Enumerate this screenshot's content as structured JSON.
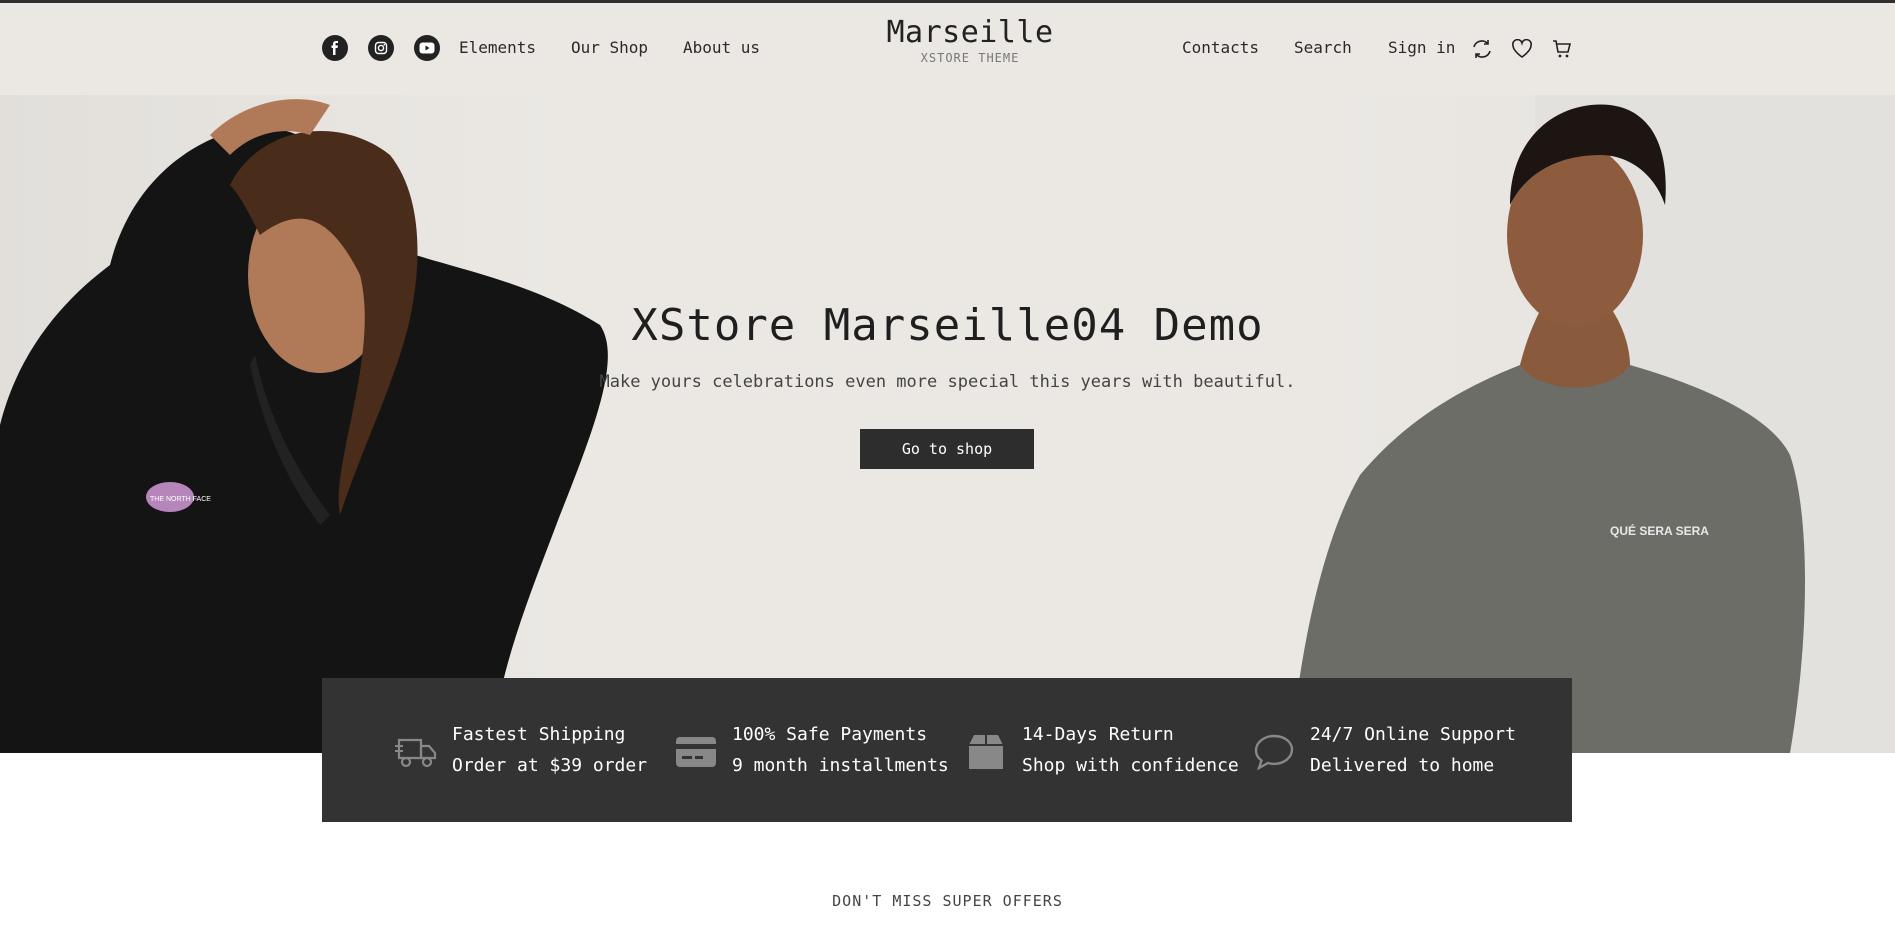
{
  "header": {
    "nav_left": [
      "Elements",
      "Our Shop",
      "About us"
    ],
    "logo_title": "Marseille",
    "logo_subtitle": "XSTORE THEME",
    "nav_right": [
      "Contacts",
      "Search",
      "Sign in"
    ],
    "social_icons": [
      "facebook-icon",
      "instagram-icon",
      "youtube-icon"
    ],
    "action_icons": [
      "compare-icon",
      "heart-icon",
      "cart-icon"
    ]
  },
  "hero": {
    "title": "XStore Marseille04 Demo",
    "subtitle": "Make yours celebrations even more special this years with beautiful.",
    "button_label": "Go to shop",
    "left_badge": "THE NORTH FACE",
    "right_print": "QUÉ SERA SERA"
  },
  "features": [
    {
      "icon": "truck-icon",
      "title": "Fastest Shipping",
      "text": "Order at $39 order"
    },
    {
      "icon": "credit-card-icon",
      "title": "100% Safe Payments",
      "text": "9 month installments"
    },
    {
      "icon": "box-icon",
      "title": "14-Days Return",
      "text": "Shop with confidence"
    },
    {
      "icon": "chat-bubble-icon",
      "title": "24/7 Online Support",
      "text": "Delivered to home"
    }
  ],
  "offers_heading": "DON'T MISS SUPER OFFERS",
  "colors": {
    "dark": "#333333",
    "hero_bg": "#ebe8e4",
    "accent": "#2d2d2d"
  }
}
